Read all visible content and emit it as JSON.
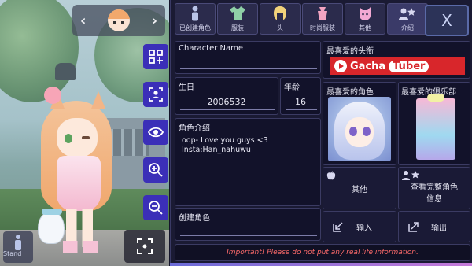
{
  "scene": {
    "head_selector": {
      "prev": "‹",
      "next": "›"
    },
    "tools": [
      {
        "name": "qr-tool-button",
        "icon": "qr-add-icon"
      },
      {
        "name": "scan-tool-button",
        "icon": "scan-person-icon"
      },
      {
        "name": "eye-tool-button",
        "icon": "eye-icon"
      },
      {
        "name": "zoom-in-button",
        "icon": "zoom-in-icon"
      },
      {
        "name": "zoom-out-button",
        "icon": "zoom-out-icon"
      }
    ],
    "stand_label": "Stand"
  },
  "tabs": [
    {
      "label": "已创建角色",
      "icon": "person-icon"
    },
    {
      "label": "服装",
      "icon": "shirt-icon"
    },
    {
      "label": "头",
      "icon": "hair-icon"
    },
    {
      "label": "时尚服装",
      "icon": "fashion-icon"
    },
    {
      "label": "其他",
      "icon": "cat-icon"
    },
    {
      "label": "介绍",
      "icon": "profile-star-icon"
    }
  ],
  "close_label": "X",
  "profile": {
    "name_label": "Character Name",
    "name_value": "",
    "birthday_label": "生日",
    "birthday_value": "2006532",
    "age_label": "年龄",
    "age_value": "16",
    "desc_label": "角色介绍",
    "desc_line1": "oop- Love you guys <3",
    "desc_line2": "Insta:Han_nahuwu",
    "create_label": "创建角色",
    "create_value": ""
  },
  "favorites": {
    "head_label": "最喜爱的头衔",
    "gacha_logo_left": "Gacha",
    "gacha_logo_right": "Tuber",
    "char_label": "最喜爱的角色",
    "club_label": "最喜爱的俱乐部"
  },
  "actions": {
    "other_label": "其他",
    "detail_label_1": "查看完整角色",
    "detail_label_2": "信息",
    "import_label": "输入",
    "export_label": "输出"
  },
  "footer_text": "Important! Please do not put any real life information.",
  "colors": {
    "accent": "#3b2fb8",
    "warning": "#ff6b6b",
    "logo_red": "#d8262b"
  }
}
